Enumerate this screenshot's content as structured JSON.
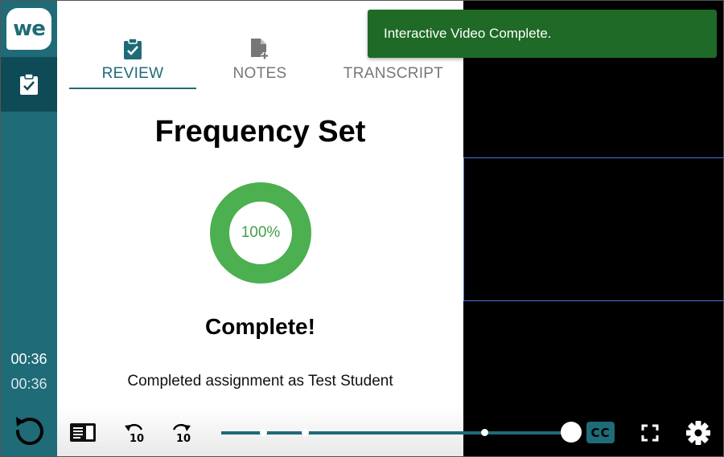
{
  "app": {
    "logo_text": "we"
  },
  "rail": {
    "current_time": "00:36",
    "duration": "00:36"
  },
  "tabs": [
    {
      "label": "REVIEW",
      "icon": "clipboard-check-icon",
      "active": true
    },
    {
      "label": "NOTES",
      "icon": "note-add-icon",
      "active": false
    },
    {
      "label": "TRANSCRIPT",
      "icon": "transcript-icon",
      "active": false
    }
  ],
  "review": {
    "title": "Frequency Set",
    "progress_percent": 100,
    "progress_label": "100%",
    "status": "Complete!",
    "message": "Completed assignment as Test Student"
  },
  "toast": {
    "message": "Interactive Video Complete."
  },
  "controls": {
    "cc_label": "CC",
    "rewind_seconds": "10",
    "forward_seconds": "10",
    "playback_progress": 1.0,
    "markers": [
      0.12,
      0.24,
      0.75
    ]
  },
  "colors": {
    "accent": "#1f6b78",
    "success": "#4caf50",
    "toast": "#1e6a26"
  }
}
